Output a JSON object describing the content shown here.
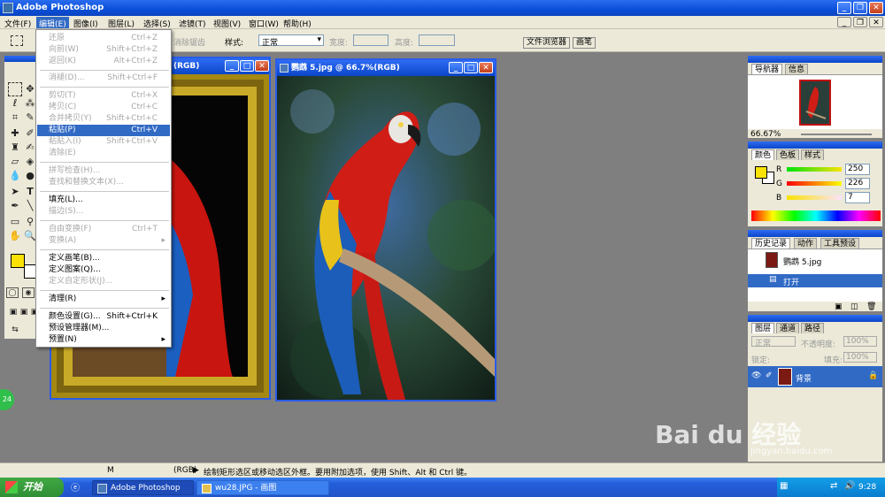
{
  "app": {
    "title": "Adobe Photoshop"
  },
  "menubar": [
    "文件(F)",
    "编辑(E)",
    "图像(I)",
    "图层(L)",
    "选择(S)",
    "滤镜(T)",
    "视图(V)",
    "窗口(W)",
    "帮助(H)"
  ],
  "options": {
    "feather_label": "消除锯齿",
    "style_label": "样式:",
    "style_value": "正常",
    "width_label": "宽度:",
    "height_label": "高度:",
    "file_browser": "文件浏览器",
    "brushes": "画笔"
  },
  "edit_menu": {
    "items": [
      {
        "label": "还原",
        "shortcut": "Ctrl+Z",
        "state": "disabled"
      },
      {
        "label": "向前(W)",
        "shortcut": "Shift+Ctrl+Z",
        "state": "disabled"
      },
      {
        "label": "返回(K)",
        "shortcut": "Alt+Ctrl+Z",
        "state": "disabled"
      },
      {
        "label": "消褪(D)...",
        "shortcut": "Shift+Ctrl+F",
        "state": "disabled"
      },
      {
        "label": "剪切(T)",
        "shortcut": "Ctrl+X",
        "state": "disabled"
      },
      {
        "label": "拷贝(C)",
        "shortcut": "Ctrl+C",
        "state": "disabled"
      },
      {
        "label": "合并拷贝(Y)",
        "shortcut": "Shift+Ctrl+C",
        "state": "disabled"
      },
      {
        "label": "粘贴(P)",
        "shortcut": "Ctrl+V",
        "state": "highlighted"
      },
      {
        "label": "粘贴入(I)",
        "shortcut": "Shift+Ctrl+V",
        "state": "disabled"
      },
      {
        "label": "清除(E)",
        "shortcut": "",
        "state": "disabled"
      },
      {
        "label": "拼写检查(H)...",
        "shortcut": "",
        "state": "disabled"
      },
      {
        "label": "查找和替换文本(X)...",
        "shortcut": "",
        "state": "disabled"
      },
      {
        "label": "填充(L)...",
        "shortcut": "",
        "state": "enabled"
      },
      {
        "label": "描边(S)...",
        "shortcut": "",
        "state": "disabled"
      },
      {
        "label": "自由变换(F)",
        "shortcut": "Ctrl+T",
        "state": "disabled"
      },
      {
        "label": "变换(A)",
        "shortcut": "",
        "state": "disabled",
        "submenu": true
      },
      {
        "label": "定义画笔(B)...",
        "shortcut": "",
        "state": "enabled"
      },
      {
        "label": "定义图案(Q)...",
        "shortcut": "",
        "state": "enabled"
      },
      {
        "label": "定义自定形状(J)...",
        "shortcut": "",
        "state": "disabled"
      },
      {
        "label": "清理(R)",
        "shortcut": "",
        "state": "enabled",
        "submenu": true
      },
      {
        "label": "颜色设置(G)...",
        "shortcut": "Shift+Ctrl+K",
        "state": "enabled"
      },
      {
        "label": "预设管理器(M)...",
        "shortcut": "",
        "state": "enabled"
      },
      {
        "label": "预置(N)",
        "shortcut": "",
        "state": "enabled",
        "submenu": true
      }
    ]
  },
  "doc_back": {
    "title": "(RGB)"
  },
  "doc_front": {
    "title": "鹦鹉 5.jpg @ 66.7%(RGB)"
  },
  "navigator": {
    "tabs": [
      "导航器",
      "信息"
    ],
    "zoom": "66.67%"
  },
  "color": {
    "tabs": [
      "颜色",
      "色板",
      "样式"
    ],
    "channels": [
      {
        "label": "R",
        "value": "250"
      },
      {
        "label": "G",
        "value": "226"
      },
      {
        "label": "B",
        "value": "7"
      }
    ],
    "foreground": "#fae207"
  },
  "history": {
    "tabs": [
      "历史记录",
      "动作",
      "工具预设"
    ],
    "snapshot": "鹦鹉 5.jpg",
    "step": "打开"
  },
  "layers": {
    "tabs": [
      "图层",
      "通道",
      "路径"
    ],
    "mode": "正常",
    "opacity_label": "不透明度:",
    "opacity": "100%",
    "lock_label": "锁定:",
    "fill_label": "填充:",
    "fill": "100%",
    "layer_name": "背景"
  },
  "statusbar": {
    "left_text": "M",
    "doc_text": "(RGB)",
    "hint": "绘制矩形选区或移动选区外框。要用附加选项，使用 Shift、Alt 和 Ctrl 键。"
  },
  "taskbar": {
    "start": "开始",
    "tasks": [
      "Adobe Photoshop",
      "wu28.JPG - 画图"
    ],
    "clock": "9:28"
  },
  "watermark": {
    "brand": "Bai du 经验",
    "url": "jingyan.baidu.com"
  },
  "badge": "24"
}
